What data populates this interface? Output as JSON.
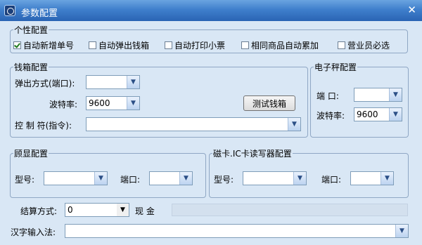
{
  "window": {
    "title": "参数配置"
  },
  "personal": {
    "legend": "个性配置",
    "options": [
      {
        "label": "自动新增单号",
        "checked": true
      },
      {
        "label": "自动弹出钱箱",
        "checked": false
      },
      {
        "label": "自动打印小票",
        "checked": false
      },
      {
        "label": "相同商品自动累加",
        "checked": false
      },
      {
        "label": "营业员必选",
        "checked": false
      }
    ]
  },
  "cashbox": {
    "legend": "钱箱配置",
    "popup_label": "弹出方式(端口):",
    "popup_value": "",
    "baud_label": "波特率:",
    "baud_value": "9600",
    "test_button": "测试钱箱",
    "control_label": "控 制 符(指令):",
    "control_value": ""
  },
  "scale": {
    "legend": "电子秤配置",
    "port_label": "端  口:",
    "port_value": "",
    "baud_label": "波特率:",
    "baud_value": "9600"
  },
  "display": {
    "legend": "顾显配置",
    "model_label": "型号:",
    "model_value": "",
    "port_label": "端口:",
    "port_value": ""
  },
  "card": {
    "legend": "磁卡.IC卡读写器配置",
    "model_label": "型号:",
    "model_value": "",
    "port_label": "端口:",
    "port_value": ""
  },
  "settlement": {
    "label": "结算方式:",
    "value": "0",
    "name": "现  金"
  },
  "ime": {
    "label": "汉字输入法:",
    "value": ""
  }
}
